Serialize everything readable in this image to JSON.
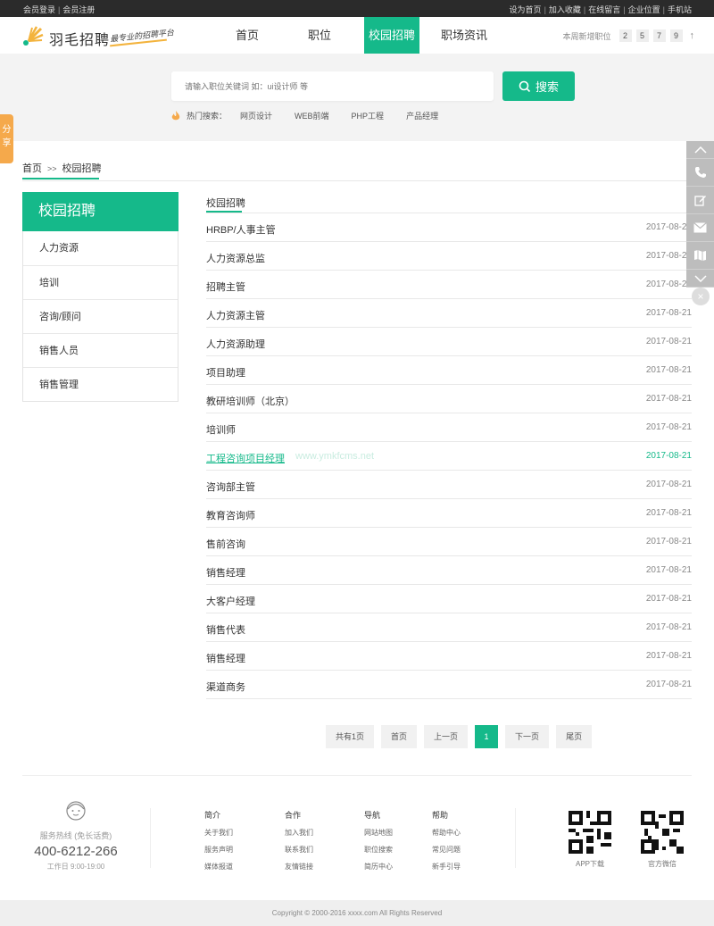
{
  "topbar": {
    "left": [
      "会员登录",
      "会员注册"
    ],
    "right": [
      "设为首页",
      "加入收藏",
      "在线留言",
      "企业位置",
      "手机站"
    ]
  },
  "header": {
    "logo_name": "羽毛招聘",
    "logo_slogan": "最专业的招聘平台",
    "nav": [
      "首页",
      "职位",
      "校园招聘",
      "职场资讯"
    ],
    "nav_active": "校园招聘",
    "newjobs_label": "本周新增职位",
    "newjobs_digits": [
      "2",
      "5",
      "7",
      "9"
    ],
    "up_icon": "up-arrow-icon"
  },
  "search": {
    "placeholder": "请输入职位关键词 如：ui设计师 等",
    "button_label": "搜索",
    "hot_label": "热门搜索：",
    "hot_terms": [
      "网页设计",
      "WEB前端",
      "PHP工程",
      "产品经理"
    ]
  },
  "share_label": "分享",
  "breadcrumb": {
    "home": "首页",
    "sep": ">>",
    "current": "校园招聘"
  },
  "sidebar": {
    "title": "校园招聘",
    "items": [
      "人力资源",
      "培训",
      "咨询/顾问",
      "销售人员",
      "销售管理"
    ]
  },
  "list": {
    "title": "校园招聘",
    "ghost_text": "www.ymkfcms.net",
    "jobs": [
      {
        "name": "HRBP/人事主管",
        "date": "2017-08-21"
      },
      {
        "name": "人力资源总监",
        "date": "2017-08-21"
      },
      {
        "name": "招聘主管",
        "date": "2017-08-21"
      },
      {
        "name": "人力资源主管",
        "date": "2017-08-21"
      },
      {
        "name": "人力资源助理",
        "date": "2017-08-21"
      },
      {
        "name": "项目助理",
        "date": "2017-08-21"
      },
      {
        "name": "教研培训师（北京）",
        "date": "2017-08-21"
      },
      {
        "name": "培训师",
        "date": "2017-08-21"
      },
      {
        "name": "工程咨询项目经理",
        "date": "2017-08-21"
      },
      {
        "name": "咨询部主管",
        "date": "2017-08-21"
      },
      {
        "name": "教育咨询师",
        "date": "2017-08-21"
      },
      {
        "name": "售前咨询",
        "date": "2017-08-21"
      },
      {
        "name": "销售经理",
        "date": "2017-08-21"
      },
      {
        "name": "大客户经理",
        "date": "2017-08-21"
      },
      {
        "name": "销售代表",
        "date": "2017-08-21"
      },
      {
        "name": "销售经理",
        "date": "2017-08-21"
      },
      {
        "name": "渠道商务",
        "date": "2017-08-21"
      }
    ]
  },
  "pager": {
    "total": "共有1页",
    "first": "首页",
    "prev": "上一页",
    "current": "1",
    "next": "下一页",
    "last": "尾页"
  },
  "footer": {
    "hotline_label": "服务热线 (免长话费)",
    "hotline_number": "400-6212-266",
    "hours": "工作日 9:00-19:00",
    "cols": [
      {
        "title": "简介",
        "links": [
          "关于我们",
          "服务声明",
          "媒体报道"
        ]
      },
      {
        "title": "合作",
        "links": [
          "加入我们",
          "联系我们",
          "友情链接"
        ]
      },
      {
        "title": "导航",
        "links": [
          "网站地图",
          "职位搜索",
          "简历中心"
        ]
      },
      {
        "title": "帮助",
        "links": [
          "帮助中心",
          "常见问题",
          "新手引导"
        ]
      }
    ],
    "qr": [
      "APP下载",
      "官方微信"
    ],
    "copyright": "Copyright © 2000-2016 xxxx.com All Rights Reserved"
  },
  "colors": {
    "accent": "#15b98a",
    "topbar": "#2b2b2b",
    "share": "#f5a94b"
  }
}
